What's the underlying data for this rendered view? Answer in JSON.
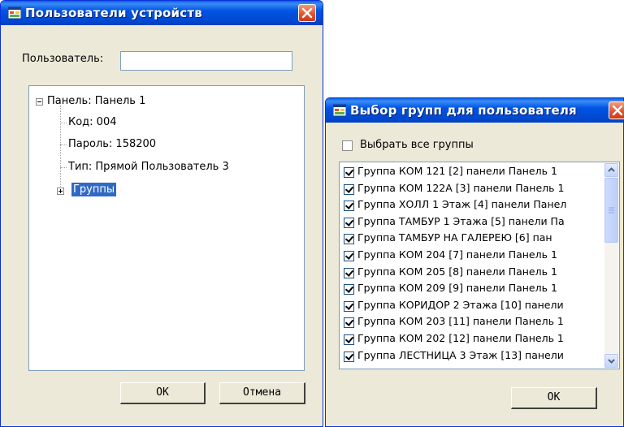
{
  "dialog_users": {
    "title": "Пользователи устройств",
    "user_label": "Пользователь:",
    "user_value": "",
    "tree": {
      "root": "Панель: Панель 1",
      "code": "Код: 004",
      "password": "Пароль: 158200",
      "type": "Тип: Прямой Пользователь 3",
      "groups": "Группы"
    },
    "ok_label": "OK",
    "cancel_label": "Отмена"
  },
  "dialog_groups": {
    "title": "Выбор групп для пользователя",
    "select_all_label": "Выбрать все группы",
    "select_all_checked": false,
    "items": [
      {
        "label": "Группа КОМ 121 [2] панели Панель 1",
        "checked": true
      },
      {
        "label": "Группа КОМ 122А [3] панели Панель 1",
        "checked": true
      },
      {
        "label": "Группа ХОЛЛ 1 Этаж [4] панели Панел",
        "checked": true
      },
      {
        "label": "Группа ТАМБУР 1 Этажа [5] панели Па",
        "checked": true
      },
      {
        "label": "Группа ТАМБУР НА ГАЛЕРЕЮ [6] пан",
        "checked": true
      },
      {
        "label": "Группа КОМ 204 [7] панели Панель 1",
        "checked": true
      },
      {
        "label": "Группа КОМ 205 [8] панели Панель 1",
        "checked": true
      },
      {
        "label": "Группа КОМ 209 [9] панели Панель 1",
        "checked": true
      },
      {
        "label": "Группа КОРИДОР 2 Этажа [10] панели",
        "checked": true
      },
      {
        "label": "Группа КОМ 203 [11] панели Панель 1",
        "checked": true
      },
      {
        "label": "Группа КОМ 202 [12] панели Панель 1",
        "checked": true
      },
      {
        "label": "Группа ЛЕСТНИЦА 3 Этаж [13] панели",
        "checked": true
      }
    ],
    "ok_label": "OK"
  },
  "colors": {
    "titlebar": "#0054E3",
    "window_bg": "#ECE9D8",
    "selection": "#316AC5",
    "close_button": "#E2502B"
  }
}
